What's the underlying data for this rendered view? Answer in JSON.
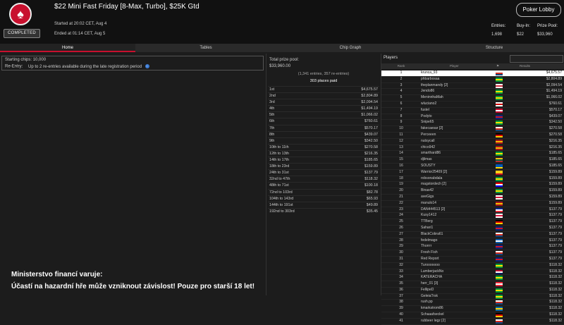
{
  "header": {
    "title": "$22 Mini Fast Friday [8-Max, Turbo], $25K Gtd",
    "started": "Started at 20:02 CET, Aug 4",
    "ended": "Ended at 01:14 CET, Aug 5",
    "status": "COMPLETED",
    "lobby_button": "Poker Lobby",
    "entries_label": "Entries:",
    "entries_value": "1,698",
    "buyin_label": "Buy-In:",
    "buyin_value": "$22",
    "prizepool_label": "Prize Pool:",
    "prizepool_value": "$33,960"
  },
  "tabs": [
    "Home",
    "Tables",
    "Chip Graph",
    "Structure"
  ],
  "home": {
    "starting_chips_label": "Starting chips:",
    "starting_chips_value": "10,000",
    "reentry_label": "Re-Entry:",
    "reentry_value": "Up to 2 re-entries available during the late registration period"
  },
  "prize": {
    "label": "Total prize pool:",
    "value": "$33,960.00",
    "entries": "(1,341 entries, 357 re-entries)",
    "paid": "303 places paid",
    "rows": [
      {
        "place": "1st",
        "amount": "$4,675.57"
      },
      {
        "place": "2nd",
        "amount": "$2,804.89"
      },
      {
        "place": "3rd",
        "amount": "$2,094.54"
      },
      {
        "place": "4th",
        "amount": "$1,494.19"
      },
      {
        "place": "5th",
        "amount": "$1,066.02"
      },
      {
        "place": "6th",
        "amount": "$760.61"
      },
      {
        "place": "7th",
        "amount": "$570.17"
      },
      {
        "place": "8th",
        "amount": "$439.07"
      },
      {
        "place": "9th",
        "amount": "$342.50"
      },
      {
        "place": "10th to 11th",
        "amount": "$270.58"
      },
      {
        "place": "12th to 13th",
        "amount": "$216.35"
      },
      {
        "place": "14th to 17th",
        "amount": "$185.65"
      },
      {
        "place": "18th to 23rd",
        "amount": "$159.89"
      },
      {
        "place": "24th to 31st",
        "amount": "$137.79"
      },
      {
        "place": "32nd to 47th",
        "amount": "$118.32"
      },
      {
        "place": "48th to 71st",
        "amount": "$100.18"
      },
      {
        "place": "72nd to 103rd",
        "amount": "$82.78"
      },
      {
        "place": "104th to 143rd",
        "amount": "$65.93"
      },
      {
        "place": "144th to 191st",
        "amount": "$49.89"
      },
      {
        "place": "192nd to 303rd",
        "amount": "$35.45"
      }
    ]
  },
  "players": {
    "title": "Players",
    "headers": {
      "rank": "Rank",
      "player": "Player",
      "results": "Results"
    },
    "rows": [
      {
        "rank": "1",
        "name": "krunca_93",
        "result": "$4,675.57",
        "flag": [
          "#ffffff",
          "#d52b1e",
          "#11457e"
        ]
      },
      {
        "rank": "2",
        "name": "phbarbosaa",
        "result": "$2,804.89",
        "flag": [
          "#009c3b",
          "#ffdf00",
          "#009c3b"
        ]
      },
      {
        "rank": "3",
        "name": "theplanmandy [2]",
        "result": "$2,094.54",
        "flag": [
          "#ffffff",
          "#cd2e3a",
          "#ffffff"
        ]
      },
      {
        "rank": "4",
        "name": "Jendo86",
        "result": "$1,494.19",
        "flag": [
          "#009c3b",
          "#ffdf00",
          "#009c3b"
        ]
      },
      {
        "rank": "5",
        "name": "MeninnhaMah",
        "result": "$1,066.02",
        "flag": [
          "#009c3b",
          "#ffdf00",
          "#009c3b"
        ]
      },
      {
        "rank": "6",
        "name": "wluciano2",
        "result": "$760.61",
        "flag": [
          "#ffffff",
          "#cc0001",
          "#ffffff"
        ]
      },
      {
        "rank": "7",
        "name": "fustel",
        "result": "$570.17",
        "flag": [
          "#c60c30",
          "#ffffff",
          "#c60c30"
        ]
      },
      {
        "rank": "8",
        "name": "Podyto",
        "result": "$439.07",
        "flag": [
          "#00247d",
          "#cf142b",
          "#00247d"
        ]
      },
      {
        "rank": "9",
        "name": "Snipe65",
        "result": "$342.50",
        "flag": [
          "#009c3b",
          "#ffdf00",
          "#009c3b"
        ]
      },
      {
        "rank": "10",
        "name": "fakecaesar [2]",
        "result": "$270.58",
        "flag": [
          "#ffffff",
          "#d52b1e",
          "#11457e"
        ]
      },
      {
        "rank": "11",
        "name": "Perceeen",
        "result": "$270.58",
        "flag": [
          "#000000",
          "#dd0000",
          "#ffce00"
        ]
      },
      {
        "rank": "12",
        "name": "nutsycall",
        "result": "$216.35",
        "flag": [
          "#aa151b",
          "#f1bf00",
          "#aa151b"
        ]
      },
      {
        "rank": "13",
        "name": "chico942",
        "result": "$216.35",
        "flag": [
          "#aa151b",
          "#f1bf00",
          "#aa151b"
        ]
      },
      {
        "rank": "14",
        "name": "smarthard86",
        "result": "$185.65",
        "flag": [
          "#009c3b",
          "#ffdf00",
          "#009c3b"
        ]
      },
      {
        "rank": "15",
        "name": "djlimas",
        "result": "$185.65",
        "flag": [
          "#fdb913",
          "#006a44",
          "#c1272d"
        ]
      },
      {
        "rank": "16",
        "name": "SOUSTY",
        "result": "$185.65",
        "flag": [
          "#0057b7",
          "#0057b7",
          "#ffd700"
        ]
      },
      {
        "rank": "17",
        "name": "Warrior25409 [2]",
        "result": "$159.89",
        "flag": [
          "#fcd116",
          "#fcd116",
          "#ce1126"
        ]
      },
      {
        "rank": "18",
        "name": "robsonabdala",
        "result": "$159.89",
        "flag": [
          "#009c3b",
          "#ffdf00",
          "#009c3b"
        ]
      },
      {
        "rank": "19",
        "name": "magstordech [2]",
        "result": "$159.89",
        "flag": [
          "#ff0000",
          "#ffffff",
          "#0000ff"
        ]
      },
      {
        "rank": "20",
        "name": "Binas42",
        "result": "$159.89",
        "flag": [
          "#009c3b",
          "#ffdf00",
          "#009c3b"
        ]
      },
      {
        "rank": "21",
        "name": "aveGigs",
        "result": "$159.89",
        "flag": [
          "#ffffff",
          "#dc143c",
          "#ffffff"
        ]
      },
      {
        "rank": "22",
        "name": "manulo14",
        "result": "$159.89",
        "flag": [
          "#aa151b",
          "#f1bf00",
          "#aa151b"
        ]
      },
      {
        "rank": "23",
        "name": "DAN444513 [2]",
        "result": "$137.79",
        "flag": [
          "#002395",
          "#ffffff",
          "#ed2939"
        ]
      },
      {
        "rank": "24",
        "name": "Kusy1412",
        "result": "$137.79",
        "flag": [
          "#ffffff",
          "#dc143c",
          "#ffffff"
        ]
      },
      {
        "rank": "25",
        "name": "TTBerg",
        "result": "$137.79",
        "flag": [
          "#000000",
          "#dd0000",
          "#ffce00"
        ]
      },
      {
        "rank": "26",
        "name": "Sahari1",
        "result": "$137.79",
        "flag": [
          "#00247d",
          "#cf142b",
          "#00247d"
        ]
      },
      {
        "rank": "27",
        "name": "BlackCobra61",
        "result": "$137.79",
        "flag": [
          "#ffffff",
          "#d52b1e",
          "#11457e"
        ]
      },
      {
        "rank": "28",
        "name": "fedelmago",
        "result": "$137.79",
        "flag": [
          "#0d5eaf",
          "#ffffff",
          "#0d5eaf"
        ]
      },
      {
        "rank": "29",
        "name": "Thorrrr",
        "result": "$137.79",
        "flag": [
          "#00247d",
          "#cf142b",
          "#00247d"
        ]
      },
      {
        "rank": "30",
        "name": "Fresh Fish",
        "result": "$137.79",
        "flag": [
          "#ffffff",
          "#d52b1e",
          "#11457e"
        ]
      },
      {
        "rank": "31",
        "name": "Red Report",
        "result": "$137.79",
        "flag": [
          "#00247d",
          "#cf142b",
          "#00247d"
        ]
      },
      {
        "rank": "32",
        "name": "Turooooooo",
        "result": "$118.32",
        "flag": [
          "#009c3b",
          "#ffdf00",
          "#009c3b"
        ]
      },
      {
        "rank": "33",
        "name": "LumberjackNo",
        "result": "$118.32",
        "flag": [
          "#ba0c2f",
          "#ffffff",
          "#00205b"
        ]
      },
      {
        "rank": "34",
        "name": "KATERACHA",
        "result": "$118.32",
        "flag": [
          "#009c3b",
          "#ffdf00",
          "#009c3b"
        ]
      },
      {
        "rank": "35",
        "name": "herr_01 [3]",
        "result": "$118.32",
        "flag": [
          "#ed2939",
          "#ffffff",
          "#ed2939"
        ]
      },
      {
        "rank": "36",
        "name": "FellipeD",
        "result": "$118.32",
        "flag": [
          "#009c3b",
          "#ffdf00",
          "#009c3b"
        ]
      },
      {
        "rank": "37",
        "name": "GeleiaTrsk",
        "result": "$118.32",
        "flag": [
          "#009c3b",
          "#ffdf00",
          "#009c3b"
        ]
      },
      {
        "rank": "38",
        "name": "rush.pp",
        "result": "$118.32",
        "flag": [
          "#ffffff",
          "#d52b1e",
          "#11457e"
        ]
      },
      {
        "rank": "39",
        "name": "kmarkstrom86",
        "result": "$118.32",
        "flag": [
          "#006aa7",
          "#fecc00",
          "#006aa7"
        ]
      },
      {
        "rank": "40",
        "name": "Schaaafseckel",
        "result": "$118.32",
        "flag": [
          "#000000",
          "#dd0000",
          "#ffce00"
        ]
      },
      {
        "rank": "41",
        "name": "rubbeer legz [2]",
        "result": "$118.32",
        "flag": [
          "#ffffff",
          "#d52b1e",
          "#11457e"
        ]
      }
    ]
  },
  "warning": {
    "line1": "Ministerstvo financí varuje:",
    "line2": "Účastí na hazardní hře může vzniknout závislost! Pouze pro starší 18 let!"
  },
  "colors": {
    "accent": "#c8102e",
    "background": "#1c1c1c",
    "header": "#111111"
  }
}
